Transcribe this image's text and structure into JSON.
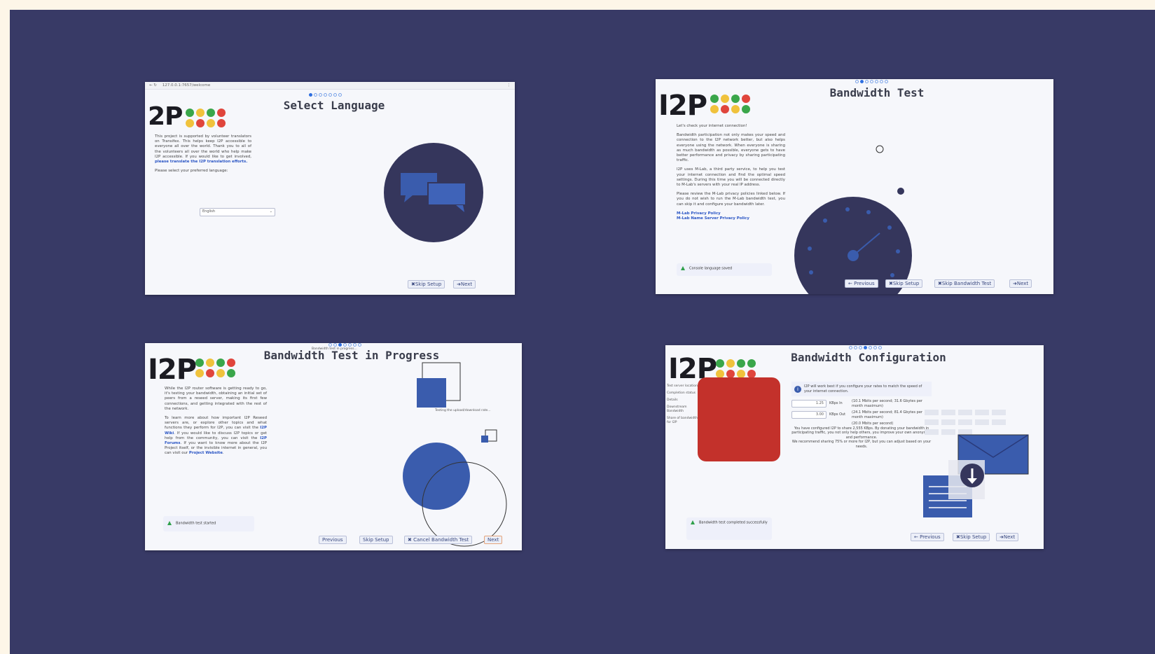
{
  "colors": {
    "background_outer": "#fdf6e8",
    "board": "#383a66",
    "accent_blue": "#3a5cad",
    "accent_red": "#c3312b",
    "dark_circle": "#35365c",
    "logo_green": "#3aa64a",
    "logo_yellow": "#f0c23c",
    "logo_red": "#e0453c"
  },
  "panels": {
    "select_language": {
      "url": "127.0.0.1:7657/welcome",
      "logo": "2P",
      "title": "Select Language",
      "paragraph": "This project is supported by volunteer translators on Transifex. This helps keep I2P accessible to everyone all over the world. Thank you to all of the volunteers all over the world who help make I2P accessible. If you would like to get involved,",
      "link": "please translate the I2P translation efforts.",
      "prompt": "Please select your preferred language:",
      "language_value": "English",
      "buttons": {
        "skip": "✖Skip Setup",
        "next": "➜Next"
      }
    },
    "bandwidth_test": {
      "logo": "I2P",
      "title": "Bandwidth Test",
      "intro": "Let's check your internet connection!",
      "p1": "Bandwidth participation not only makes your speed and connection to the I2P network better, but also helps everyone using the network. When everyone is sharing as much bandwidth as possible, everyone gets to have better performance and privacy by sharing participating traffic.",
      "p2": "I2P uses M-Lab, a third party service, to help you test your internet connection and find the optimal speed settings. During this time you will be connected directly to M-Lab's servers with your real IP address.",
      "p3": "Please review the M-Lab privacy policies linked below. If you do not wish to run the M-Lab bandwidth test, you can skip it and configure your bandwidth later.",
      "link1": "M-Lab Privacy Policy",
      "link2": "M-Lab Name Server Privacy Policy",
      "notice": "Console language saved",
      "buttons": {
        "previous": "← Previous",
        "skip": "✖Skip Setup",
        "skip_bw": "✖Skip Bandwidth Test",
        "next": "➜Next"
      }
    },
    "bandwidth_progress": {
      "logo": "I2P",
      "title": "Bandwidth Test in Progress",
      "status_top": "Bandwidth test in progress...",
      "status_line": "Testing the upload/download rate...",
      "p1": "While the I2P router software is getting ready to go, it's testing your bandwidth, obtaining an initial set of peers from a reseed server, making its first few connections, and getting integrated with the rest of the network.",
      "p2a": "To learn more about how important I2P Reseed servers are, or explore other topics and what functions they perform for I2P, you can visit the",
      "link_wiki": "I2P Wiki",
      "p2b": ". If you would like to discuss I2P topics or get help from the community, you can visit the",
      "link_forums": "I2P Forums",
      "p2c": ". If you want to know more about the I2P Project itself, or the invisible internet in general, you can visit our",
      "link_site": "Project Website",
      "notice": "Bandwidth test started",
      "buttons": {
        "previous": "Previous",
        "skip": "Skip Setup",
        "cancel": "✖ Cancel Bandwidth Test",
        "next": "Next"
      }
    },
    "bandwidth_config": {
      "logo": "I2P",
      "title": "Bandwidth Configuration",
      "side_labels": [
        "Test server location",
        "Completion status",
        "Details",
        "Downstream Bandwidth",
        "Share of bandwidth for I2P"
      ],
      "info": "I2P will work best if you configure your rates to match the speed of your internet connection.",
      "in_value": "1.25",
      "in_unit": "KBps In",
      "in_note": "(10.1 Mbits per second; 31.6 Gbytes per month maximum)",
      "out_value": "3.00",
      "out_unit": "KBps Out",
      "out_note": "(24.1 Mbits per second; 81.4 Gbytes per month maximum)",
      "share_note": "(20.0 Mbits per second)",
      "summary": "You have configured I2P to share 2,555 KBps. By donating your bandwidth in participating traffic, you not only help others, you improve your own anonymity and performance.",
      "recommend": "We recommend sharing 75% or more for I2P, but you can adjust based on your needs.",
      "notice": "Bandwidth test completed successfully",
      "buttons": {
        "previous": "← Previous",
        "skip": "✖Skip Setup",
        "next": "➜Next"
      }
    }
  }
}
